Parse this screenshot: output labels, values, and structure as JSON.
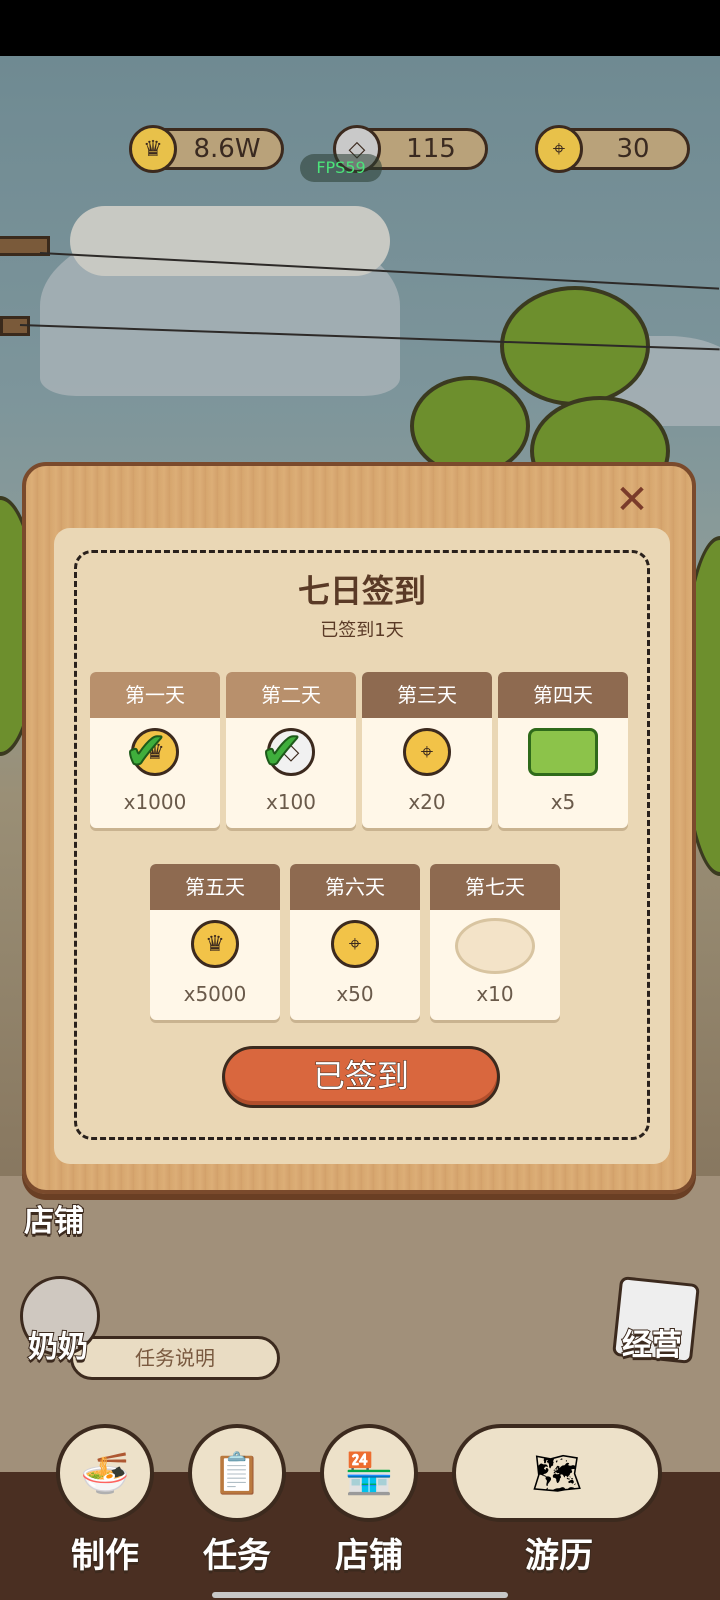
{
  "resources": [
    {
      "icon": "crown-icon",
      "glyph": "♛",
      "value": "8.6W"
    },
    {
      "icon": "diamond-icon",
      "glyph": "◇",
      "value": "115"
    },
    {
      "icon": "location-pin-icon",
      "glyph": "⌖",
      "value": "30"
    }
  ],
  "fps": "FPS59",
  "dialog": {
    "title": "七日签到",
    "subtitle": "已签到1天",
    "close_glyph": "✕",
    "sign_button": "已签到",
    "days": [
      {
        "label": "第一天",
        "qty": "x1000",
        "reward": "crown",
        "claimed": true
      },
      {
        "label": "第二天",
        "qty": "x100",
        "reward": "diamond",
        "claimed": true
      },
      {
        "label": "第三天",
        "qty": "x20",
        "reward": "location-pin",
        "claimed": false
      },
      {
        "label": "第四天",
        "qty": "x5",
        "reward": "green-onion",
        "claimed": false
      },
      {
        "label": "第五天",
        "qty": "x5000",
        "reward": "crown",
        "claimed": false
      },
      {
        "label": "第六天",
        "qty": "x50",
        "reward": "location-pin",
        "claimed": false
      },
      {
        "label": "第七天",
        "qty": "x10",
        "reward": "noodles",
        "claimed": false
      }
    ],
    "check_glyph": "✔"
  },
  "scene": {
    "shop_label": "店铺",
    "granny_label": "奶奶",
    "task_desc": "任务说明",
    "manage_label": "经营"
  },
  "bottom_nav": [
    {
      "label": "制作",
      "icon": "noodle-bowl-icon",
      "glyph": "🍜"
    },
    {
      "label": "任务",
      "icon": "clipboard-icon",
      "glyph": "📋"
    },
    {
      "label": "店铺",
      "icon": "store-icon",
      "glyph": "🏪"
    },
    {
      "label": "游历",
      "icon": "map-icon",
      "glyph": "🗺"
    }
  ]
}
